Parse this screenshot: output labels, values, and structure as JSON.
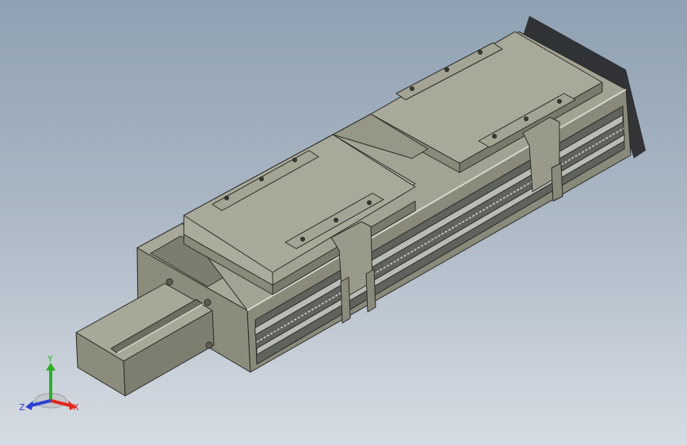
{
  "colors": {
    "body_light": "#a8a898",
    "body_mid": "#8c8c7c",
    "body_dark": "#6d6d60",
    "edge": "#2a2a26",
    "highlight": "#d8d8cf",
    "rail": "#b9bcb6",
    "axis_x": "#e0261d",
    "axis_y": "#2fae2a",
    "axis_z": "#2c3fd3"
  },
  "triad": {
    "x_label": "X",
    "y_label": "Y",
    "z_label": "Z"
  }
}
